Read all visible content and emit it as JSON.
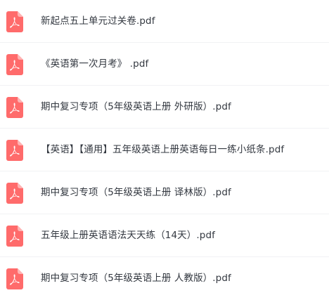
{
  "files": [
    {
      "name": "新起点五上单元过关卷.pdf",
      "icon": "pdf-file-icon"
    },
    {
      "name": "《英语第一次月考》 .pdf",
      "icon": "pdf-file-icon"
    },
    {
      "name": "期中复习专项（5年级英语上册 外研版）.pdf",
      "icon": "pdf-file-icon"
    },
    {
      "name": "【英语】【通用】五年级英语上册英语每日一练小纸条.pdf",
      "icon": "pdf-file-icon"
    },
    {
      "name": "期中复习专项（5年级英语上册 译林版）.pdf",
      "icon": "pdf-file-icon"
    },
    {
      "name": "五年级上册英语语法天天练（14天）.pdf",
      "icon": "pdf-file-icon"
    },
    {
      "name": "期中复习专项（5年级英语上册 人教版）.pdf",
      "icon": "pdf-file-icon"
    }
  ],
  "colors": {
    "icon_body": "#ff6b6b",
    "icon_fold": "#ffb3b3",
    "text": "#333840",
    "divider": "#f1f2f4"
  }
}
